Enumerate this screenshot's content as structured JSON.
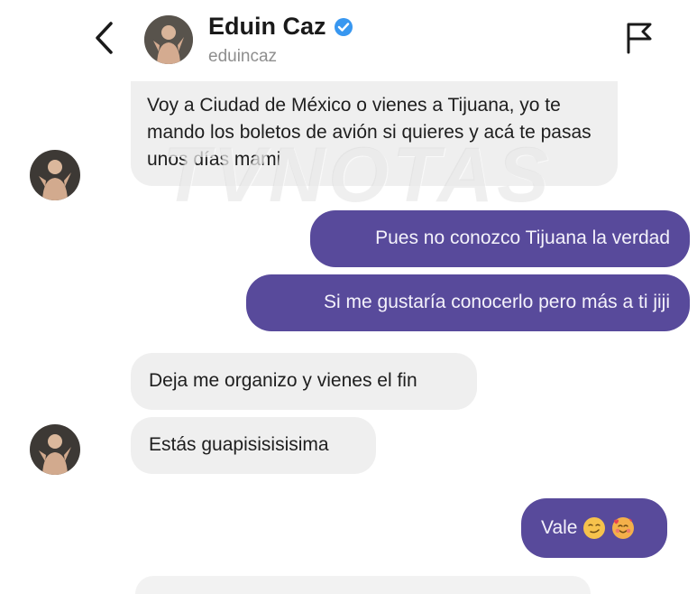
{
  "header": {
    "name": "Eduin Caz",
    "handle": "eduincaz"
  },
  "watermark": "TVNOTAS",
  "messages": [
    {
      "side": "incoming",
      "text": "Voy a Ciudad de México o vienes a Tijuana, yo te mando los boletos de avión si quieres y acá te pasas unos días mami"
    },
    {
      "side": "outgoing",
      "text": "Pues no conozco Tijuana la verdad"
    },
    {
      "side": "outgoing",
      "text": "Si me gustaría conocerlo pero más a ti jiji"
    },
    {
      "side": "incoming",
      "text": "Deja me organizo y vienes el fin"
    },
    {
      "side": "incoming",
      "text": "Estás guapisisisisima"
    },
    {
      "side": "outgoing",
      "text": "Vale"
    }
  ],
  "icons": {
    "back": "chevron-left-icon",
    "verified": "verified-badge-icon",
    "report": "flag-icon",
    "emoji_1": "smirk-emoji",
    "emoji_2": "smiling-hearts-emoji"
  },
  "colors": {
    "outgoing_bubble": "#584a9b",
    "incoming_bubble": "#efefef",
    "verified": "#3897f0"
  }
}
